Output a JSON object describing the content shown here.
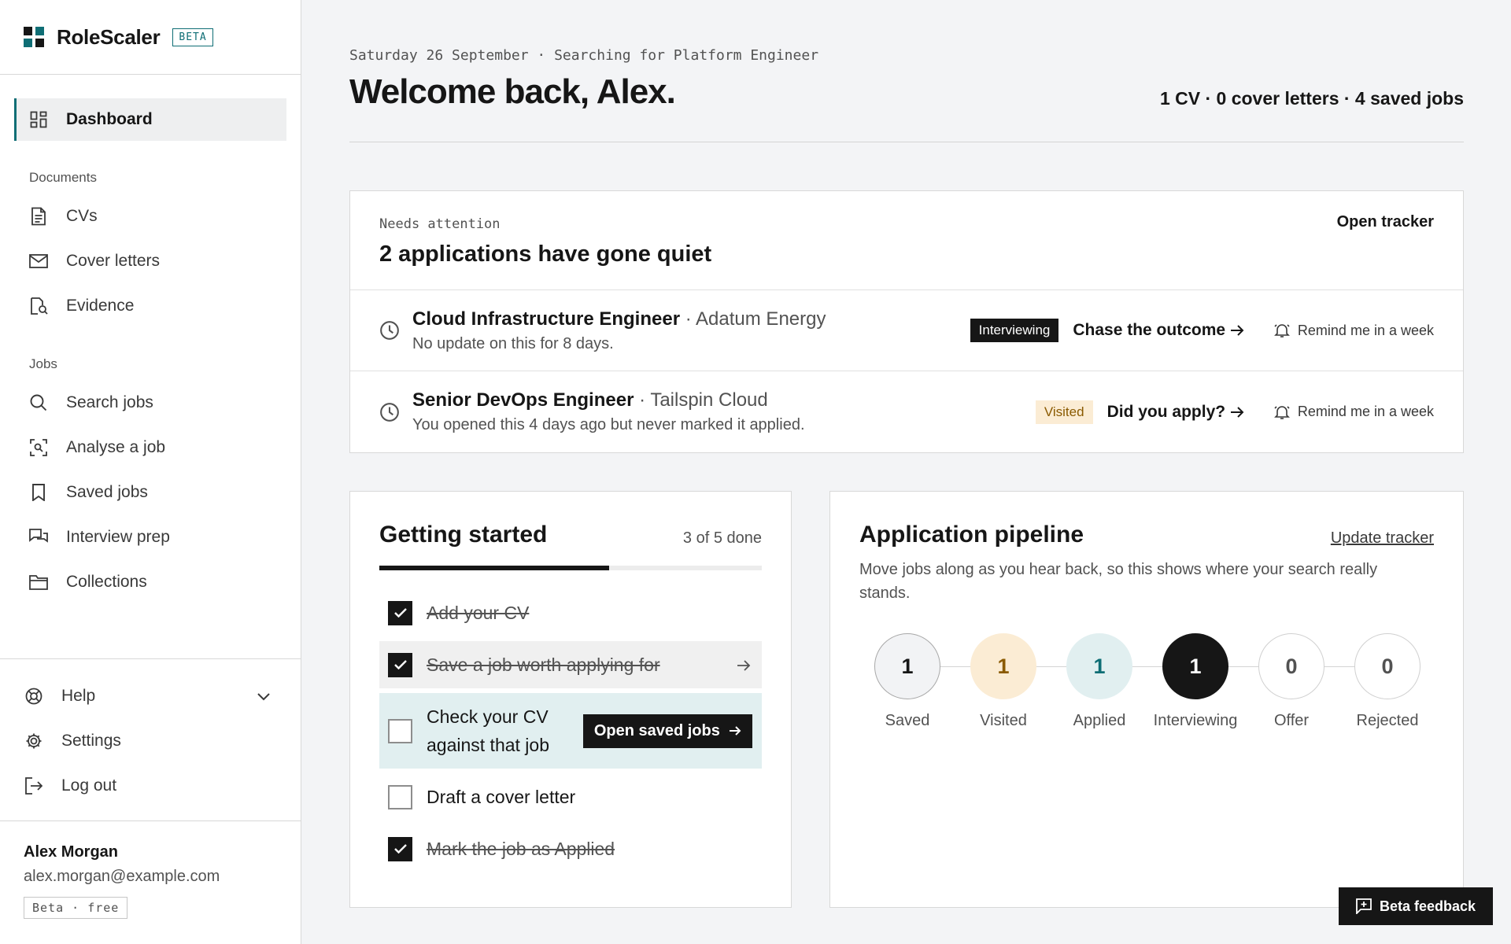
{
  "brand": {
    "name": "RoleScaler",
    "tag": "BETA",
    "colors": {
      "dark": "#161616",
      "teal": "#0f6e75"
    }
  },
  "sidebar": {
    "primary": {
      "label": "Dashboard",
      "icon": "dashboard-icon",
      "active": true
    },
    "sections": [
      {
        "title": "Documents",
        "items": [
          {
            "label": "CVs",
            "icon": "document-icon"
          },
          {
            "label": "Cover letters",
            "icon": "envelope-icon"
          },
          {
            "label": "Evidence",
            "icon": "evidence-icon"
          }
        ]
      },
      {
        "title": "Jobs",
        "items": [
          {
            "label": "Search jobs",
            "icon": "search-icon"
          },
          {
            "label": "Analyse a job",
            "icon": "scan-icon"
          },
          {
            "label": "Saved jobs",
            "icon": "bookmark-icon"
          },
          {
            "label": "Interview prep",
            "icon": "chat-icon"
          },
          {
            "label": "Collections",
            "icon": "folder-icon"
          }
        ]
      }
    ],
    "bottom": [
      {
        "label": "Help",
        "icon": "lifebuoy-icon"
      },
      {
        "label": "Settings",
        "icon": "gear-icon"
      },
      {
        "label": "Log out",
        "icon": "logout-icon"
      }
    ],
    "user": {
      "name": "Alex Morgan",
      "email": "alex.morgan@example.com",
      "plan": "Beta · free"
    }
  },
  "header": {
    "kicker": "Saturday 26 September · Searching for Platform Engineer",
    "title": "Welcome back, Alex.",
    "summary": "1 CV · 0 cover letters · 4 saved jobs"
  },
  "attention": {
    "kicker": "Needs attention",
    "title": "2 applications have gone quiet",
    "link": "Open tracker",
    "rows": [
      {
        "role": "Cloud Infrastructure Engineer",
        "company": " · Adatum Energy",
        "note": "No update on this for 8 days.",
        "status": "Interviewing",
        "action": "Chase the outcome",
        "remind": "Remind me in a week"
      },
      {
        "role": "Senior DevOps Engineer",
        "company": " · Tailspin Cloud",
        "note": "You opened this 4 days ago but never marked it applied.",
        "status": "Visited",
        "action": "Did you apply?",
        "remind": "Remind me in a week"
      }
    ]
  },
  "getting_started": {
    "title": "Getting started",
    "count": "3 of 5 done",
    "progress": 0.6,
    "items": [
      {
        "label": "Add your CV",
        "done": true
      },
      {
        "label": "Save a job worth applying for",
        "done": true
      },
      {
        "label": "Check your CV against that job",
        "done": false,
        "cta": "Open saved jobs"
      },
      {
        "label": "Draft a cover letter",
        "done": false
      },
      {
        "label": "Mark the job as Applied",
        "done": true
      }
    ]
  },
  "pipeline": {
    "title": "Application pipeline",
    "link": "Update tracker",
    "description": "Move jobs along as you hear back, so this shows where your search really stands.",
    "stages": [
      {
        "count": "1",
        "label": "Saved"
      },
      {
        "count": "1",
        "label": "Visited"
      },
      {
        "count": "1",
        "label": "Applied"
      },
      {
        "count": "1",
        "label": "Interviewing"
      },
      {
        "count": "0",
        "label": "Offer"
      },
      {
        "count": "0",
        "label": "Rejected"
      }
    ]
  },
  "feedback": {
    "label": "Beta feedback"
  }
}
